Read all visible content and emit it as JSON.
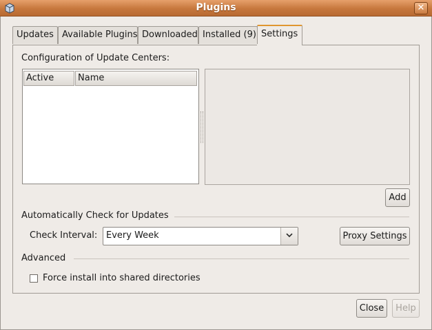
{
  "window": {
    "title": "Plugins"
  },
  "tabs": [
    {
      "label": "Updates"
    },
    {
      "label": "Available Plugins"
    },
    {
      "label": "Downloaded"
    },
    {
      "label": "Installed (9)"
    },
    {
      "label": "Settings",
      "active": true
    }
  ],
  "settings": {
    "update_centers_label": "Configuration of Update Centers:",
    "table": {
      "columns": [
        "Active",
        "Name"
      ],
      "rows": []
    },
    "add_button": "Add",
    "auto_check_heading": "Automatically Check for Updates",
    "check_interval_label": "Check Interval:",
    "check_interval_value": "Every Week",
    "proxy_button": "Proxy Settings",
    "advanced_heading": "Advanced",
    "force_install_label": "Force install into shared directories",
    "force_install_checked": false
  },
  "footer": {
    "close_button": "Close",
    "help_button": "Help"
  },
  "colors": {
    "titlebar": "#c6773d",
    "active_tab_accent": "#e0962f",
    "window_bg": "#efebe7"
  },
  "icons": [
    "app-icon",
    "close-icon",
    "chevron-down-icon"
  ]
}
